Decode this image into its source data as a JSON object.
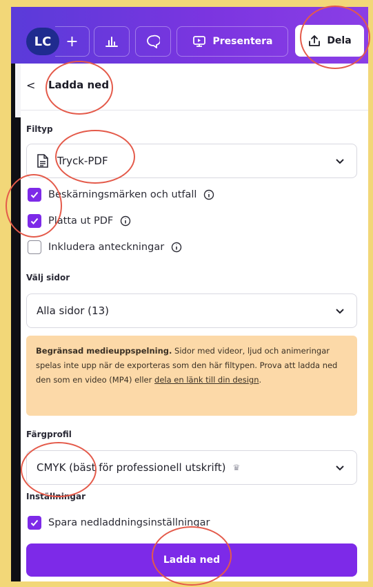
{
  "topbar": {
    "avatar_initials": "LC",
    "plus_label": "+",
    "present_label": "Presentera",
    "share_label": "Dela"
  },
  "header": {
    "back_label": "<",
    "title": "Ladda ned"
  },
  "filetype": {
    "section_label": "Filtyp",
    "selected": "Tryck-PDF",
    "options_checked": [
      {
        "label": "Beskärningsmärken och utfall",
        "checked": true
      },
      {
        "label": "Platta ut PDF",
        "checked": true
      },
      {
        "label": "Inkludera anteckningar",
        "checked": false
      }
    ]
  },
  "pages": {
    "section_label": "Välj sidor",
    "selected": "Alla sidor (13)"
  },
  "notice": {
    "bold": "Begränsad medieuppspelning.",
    "body": " Sidor med videor, ljud och animeringar spelas inte upp när de exporteras som den här filtypen. Prova att ladda ned den som en video (MP4) eller ",
    "link": "dela en länk till din design",
    "end": "."
  },
  "color_profile": {
    "section_label": "Färgprofil",
    "selected": "CMYK (bäst för professionell utskrift)"
  },
  "settings": {
    "section_label": "Inställningar",
    "save_label": "Spara nedladdningsinställningar",
    "checked": true
  },
  "download_button": "Ladda ned",
  "colors": {
    "accent": "#7d2ae8",
    "notice_bg": "#fcd9a8",
    "annotation": "#e45a4a"
  },
  "icons": [
    "plus-icon",
    "chart-icon",
    "comment-icon",
    "present-icon",
    "share-upload-icon",
    "back-chevron-icon",
    "pdf-file-icon",
    "chevron-down-icon",
    "info-icon",
    "check-icon",
    "crown-icon"
  ]
}
